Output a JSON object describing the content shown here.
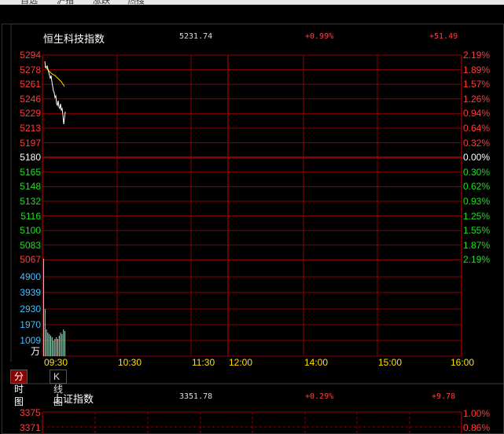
{
  "topbar": {
    "items": [
      "自选",
      "沪指",
      "涨跌",
      "热搜"
    ]
  },
  "main_chart": {
    "index_name": "恒生科技指数",
    "last_price": "5231.74",
    "change_pct": "+0.99%",
    "change_amt": "+51.49",
    "price_labels": [
      {
        "value": "5294",
        "color": "red"
      },
      {
        "value": "5278",
        "color": "red"
      },
      {
        "value": "5261",
        "color": "red"
      },
      {
        "value": "5246",
        "color": "red"
      },
      {
        "value": "5229",
        "color": "red"
      },
      {
        "value": "5213",
        "color": "red"
      },
      {
        "value": "5197",
        "color": "red"
      },
      {
        "value": "5180",
        "color": "white"
      },
      {
        "value": "5165",
        "color": "green"
      },
      {
        "value": "5148",
        "color": "green"
      },
      {
        "value": "5132",
        "color": "green"
      },
      {
        "value": "5116",
        "color": "green"
      },
      {
        "value": "5100",
        "color": "green"
      },
      {
        "value": "5083",
        "color": "green"
      },
      {
        "value": "5067",
        "color": "red"
      }
    ],
    "pct_labels": [
      {
        "value": "2.19%",
        "color": "red"
      },
      {
        "value": "1.89%",
        "color": "red"
      },
      {
        "value": "1.57%",
        "color": "red"
      },
      {
        "value": "1.26%",
        "color": "red"
      },
      {
        "value": "0.94%",
        "color": "red"
      },
      {
        "value": "0.64%",
        "color": "red"
      },
      {
        "value": "0.32%",
        "color": "red"
      },
      {
        "value": "0.00%",
        "color": "white"
      },
      {
        "value": "0.30%",
        "color": "green"
      },
      {
        "value": "0.62%",
        "color": "green"
      },
      {
        "value": "0.93%",
        "color": "green"
      },
      {
        "value": "1.25%",
        "color": "green"
      },
      {
        "value": "1.55%",
        "color": "green"
      },
      {
        "value": "1.87%",
        "color": "green"
      },
      {
        "value": "2.19%",
        "color": "green"
      }
    ],
    "volume_labels": [
      "4900",
      "3939",
      "2930",
      "1970",
      "1009"
    ],
    "volume_unit": "万",
    "time_labels": [
      "09:30",
      "10:30",
      "11:30",
      "12:00",
      "14:00",
      "15:00",
      "16:00"
    ]
  },
  "tabs": [
    {
      "label": "分时图",
      "active": true
    },
    {
      "label": "K线图",
      "active": false
    }
  ],
  "second_chart": {
    "index_name": "上证指数",
    "last_price": "3351.78",
    "change_pct": "+0.29%",
    "change_amt": "+9.78",
    "price_labels": [
      "3375",
      "3371"
    ],
    "pct_labels": [
      "1.00%",
      "0.86%"
    ]
  },
  "colors": {
    "up": "#ff3c3c",
    "down": "#22dd22",
    "grid": "#8b0000",
    "volume": "#3ec0ff",
    "time_axis": "#ffe000",
    "price_line": "#ffffff",
    "avg_line": "#ffe000"
  }
}
